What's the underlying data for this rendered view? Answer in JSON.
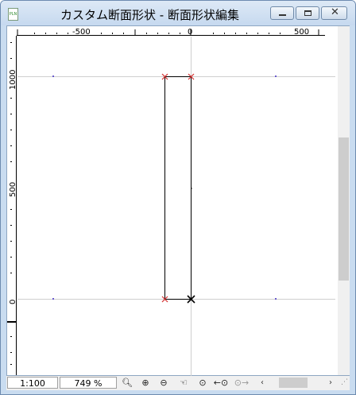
{
  "window": {
    "title": "カスタム断面形状 - 断面形状編集",
    "app_icon_label": "PLN"
  },
  "ruler": {
    "top_labels": [
      "-500",
      "0",
      "500"
    ],
    "left_labels": [
      "1000",
      "500",
      "0"
    ]
  },
  "status": {
    "scale": "1:100",
    "zoom": "749 %"
  },
  "toolbar_icons": [
    "zoom-select-icon",
    "zoom-in-icon",
    "zoom-out-icon",
    "pan-hand-icon",
    "fit-zoom-icon",
    "previous-zoom-icon",
    "next-zoom-icon"
  ],
  "shape": {
    "width_mm": 120,
    "height_mm": 1000,
    "origin_corner": "bottom-right"
  }
}
